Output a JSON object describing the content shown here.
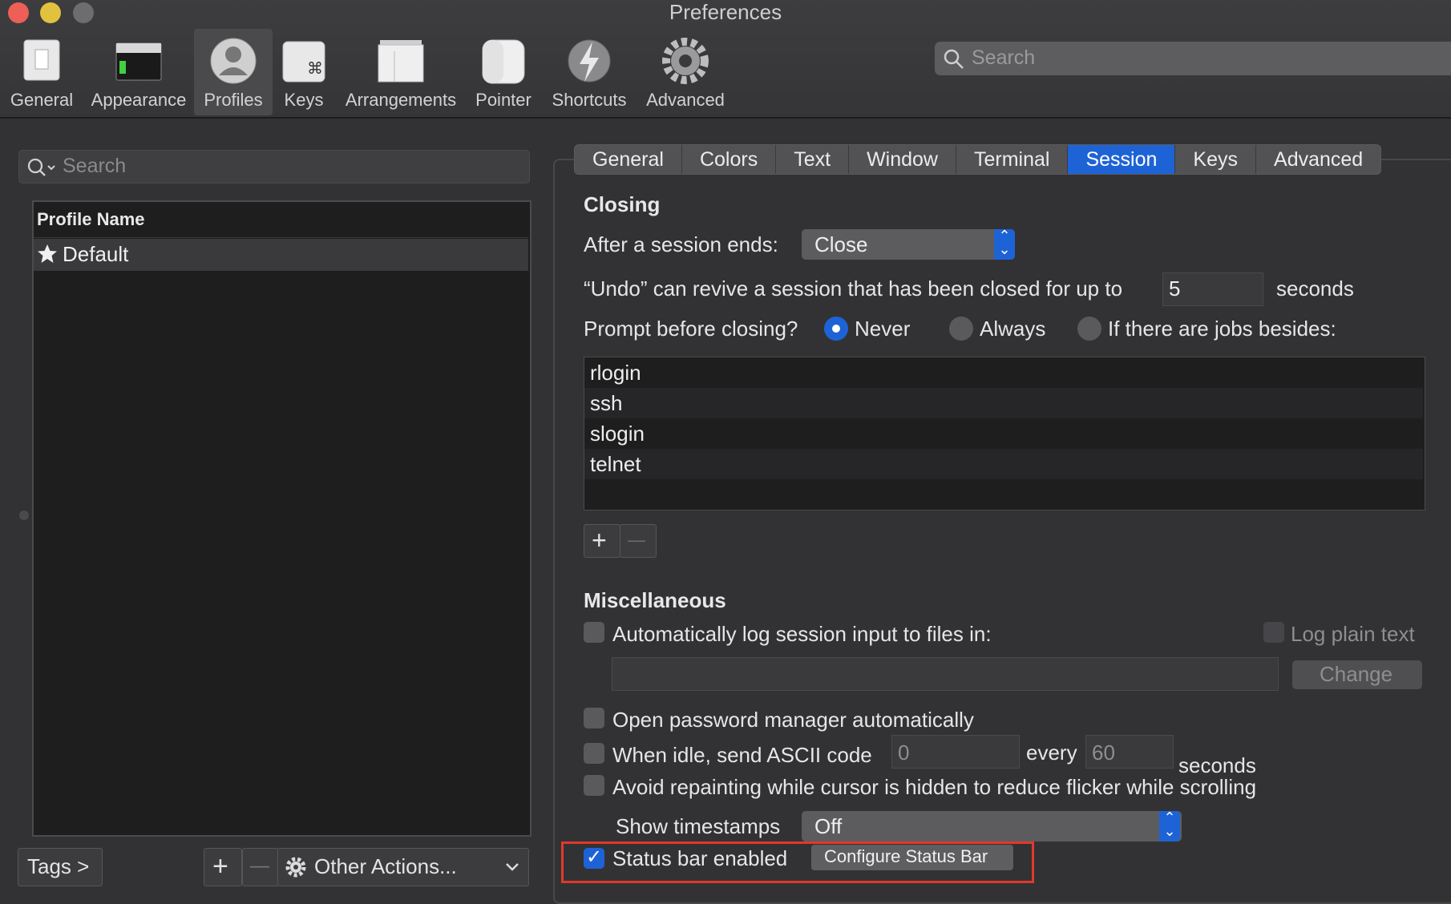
{
  "window": {
    "title": "Preferences"
  },
  "toolbar": {
    "items": [
      {
        "label": "General",
        "icon": "general-icon"
      },
      {
        "label": "Appearance",
        "icon": "appearance-icon"
      },
      {
        "label": "Profiles",
        "icon": "profiles-icon",
        "selected": true
      },
      {
        "label": "Keys",
        "icon": "command-key-icon"
      },
      {
        "label": "Arrangements",
        "icon": "arrangements-icon"
      },
      {
        "label": "Pointer",
        "icon": "mouse-icon"
      },
      {
        "label": "Shortcuts",
        "icon": "lightning-icon"
      },
      {
        "label": "Advanced",
        "icon": "gear-icon"
      }
    ],
    "search_placeholder": "Search"
  },
  "profiles": {
    "search_placeholder": "Search",
    "column_header": "Profile Name",
    "items": [
      {
        "name": "Default",
        "icon": "star-icon",
        "selected": true
      }
    ],
    "tags_button": "Tags >",
    "add_symbol": "+",
    "remove_symbol": "—",
    "other_actions": "Other Actions..."
  },
  "tabs": [
    {
      "label": "General"
    },
    {
      "label": "Colors"
    },
    {
      "label": "Text"
    },
    {
      "label": "Window"
    },
    {
      "label": "Terminal"
    },
    {
      "label": "Session",
      "active": true
    },
    {
      "label": "Keys"
    },
    {
      "label": "Advanced"
    }
  ],
  "closing": {
    "title": "Closing",
    "after_session_label": "After a session ends:",
    "after_session_value": "Close",
    "undo_label": "“Undo” can revive a session that has been closed for up to",
    "undo_value": "5",
    "undo_unit": "seconds",
    "prompt_label": "Prompt before closing?",
    "prompt_options": [
      {
        "label": "Never",
        "selected": true
      },
      {
        "label": "Always",
        "selected": false
      },
      {
        "label": "If there are jobs besides:",
        "selected": false
      }
    ],
    "jobs": [
      "rlogin",
      "ssh",
      "slogin",
      "telnet"
    ],
    "add_symbol": "+",
    "remove_symbol": "—"
  },
  "misc": {
    "title": "Miscellaneous",
    "auto_log_label": "Automatically log session input to files in:",
    "log_plain_label": "Log plain text",
    "change_button": "Change",
    "password_label": "Open password manager automatically",
    "idle_label": "When idle, send ASCII code",
    "idle_code": "0",
    "every_label": "every",
    "every_value": "60",
    "every_unit": "seconds",
    "avoid_repaint_label": "Avoid repainting while cursor is hidden to reduce flicker while scrolling",
    "timestamps_label": "Show timestamps",
    "timestamps_value": "Off",
    "status_bar_label": "Status bar enabled",
    "status_bar_enabled": true,
    "configure_button": "Configure Status Bar"
  },
  "colors": {
    "accent": "#1e63d6",
    "highlight": "#e0392b",
    "close": "#ed5f57",
    "minimize": "#e1c23e",
    "zoom": "#6d6d70"
  }
}
